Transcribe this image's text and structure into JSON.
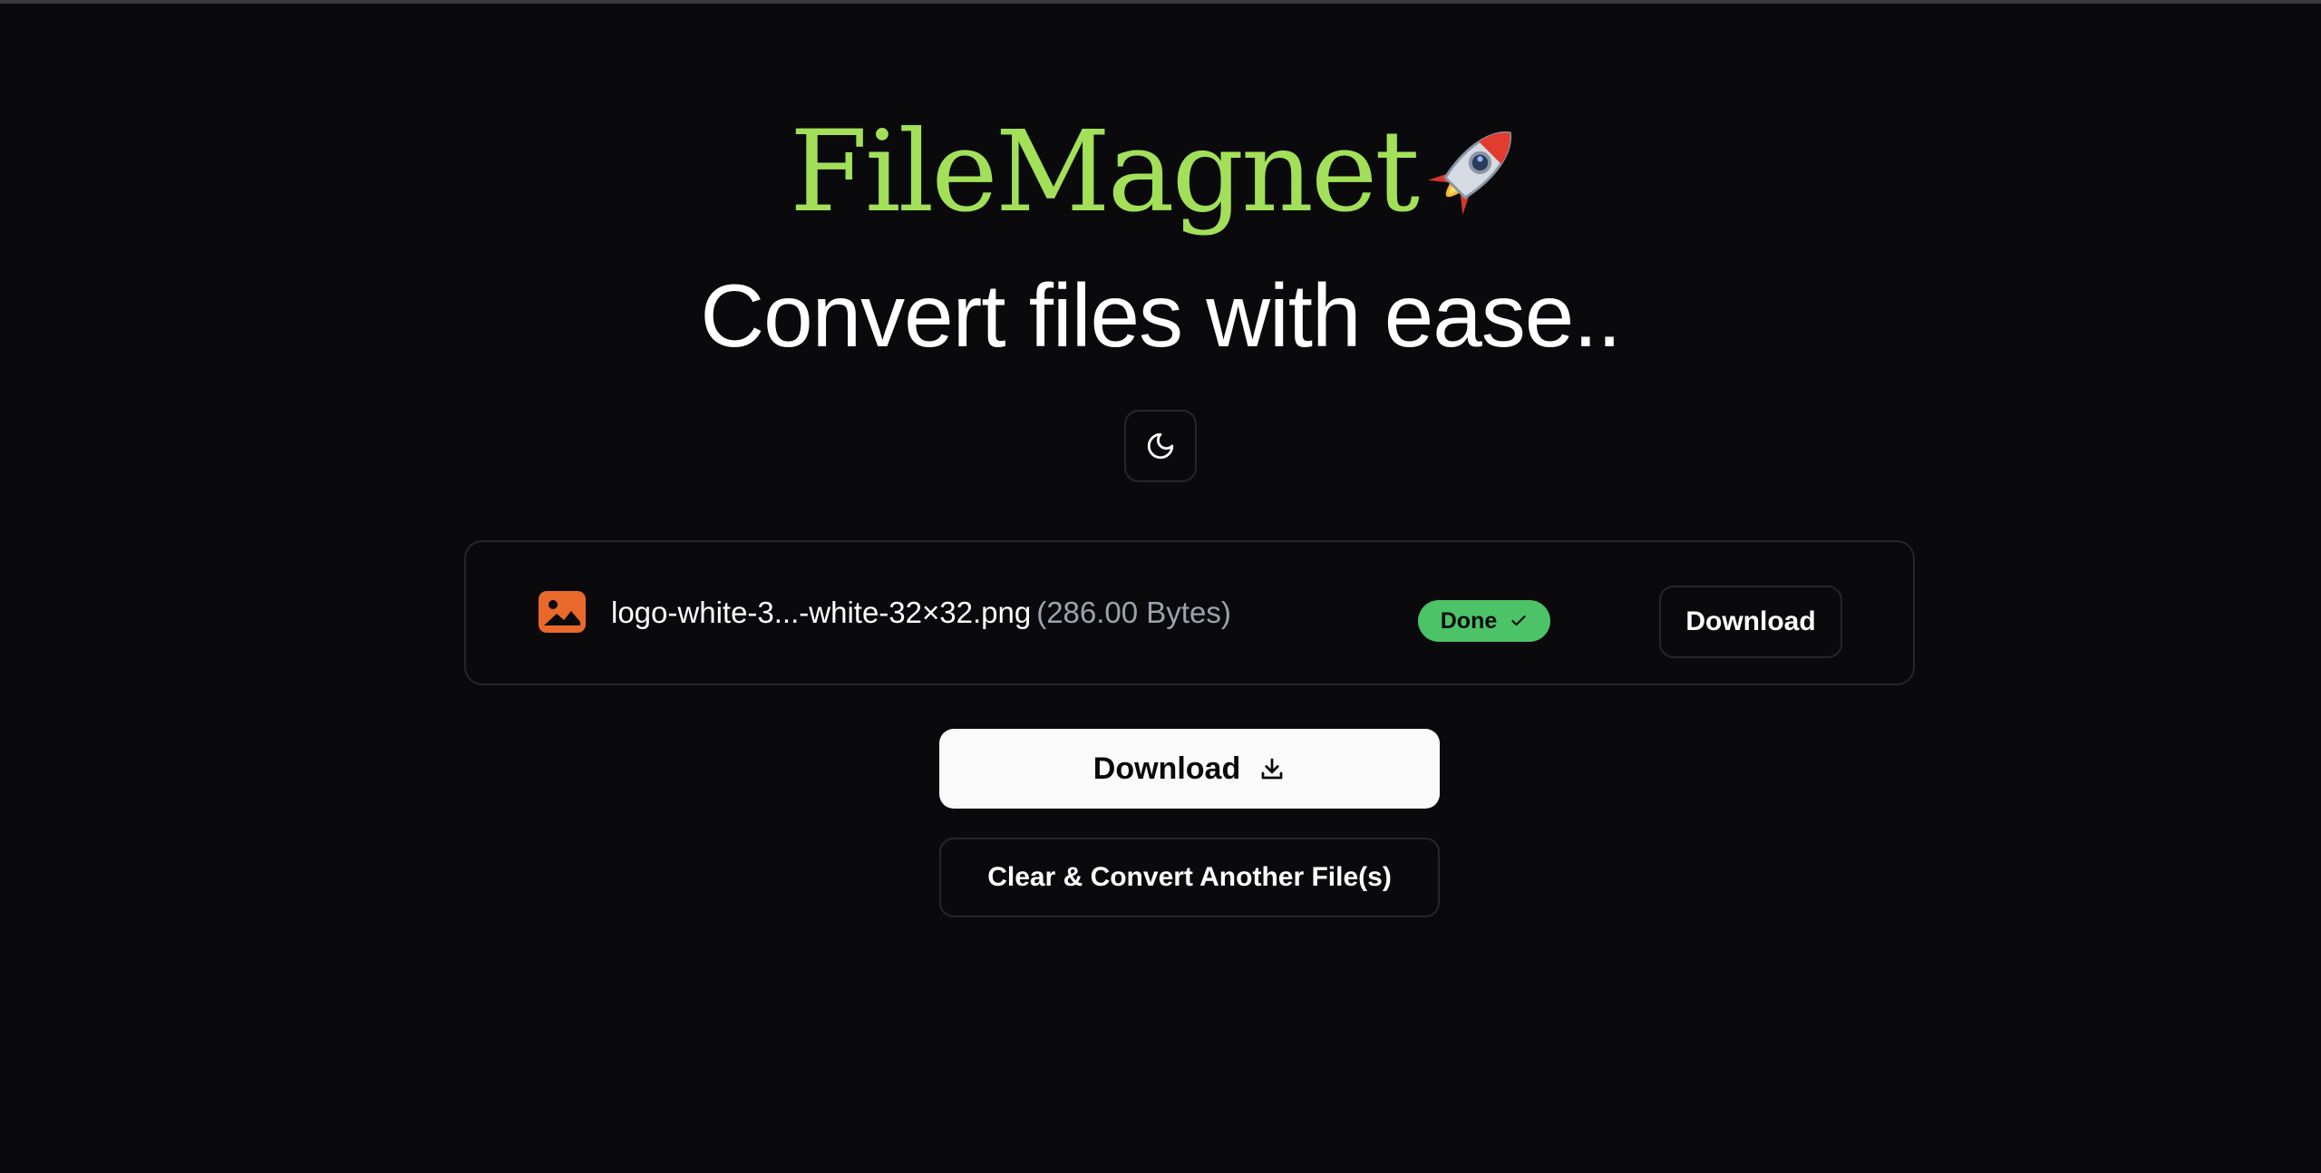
{
  "header": {
    "brand": "FileMagnet",
    "brand_color": "#a3e05a",
    "brand_emoji_icon": "rocket-icon",
    "tagline": "Convert files with ease.."
  },
  "theme_toggle": {
    "icon": "moon-icon"
  },
  "files": [
    {
      "icon": "image-icon",
      "icon_color": "#e8692a",
      "name": "logo-white-3...-white-32×32.png",
      "size": "(286.00 Bytes)",
      "status": "Done",
      "status_icon": "check-icon",
      "status_color": "#4cc366",
      "download_label": "Download"
    }
  ],
  "actions": {
    "download_label": "Download",
    "download_icon": "download-icon",
    "clear_label": "Clear & Convert Another File(s)"
  }
}
